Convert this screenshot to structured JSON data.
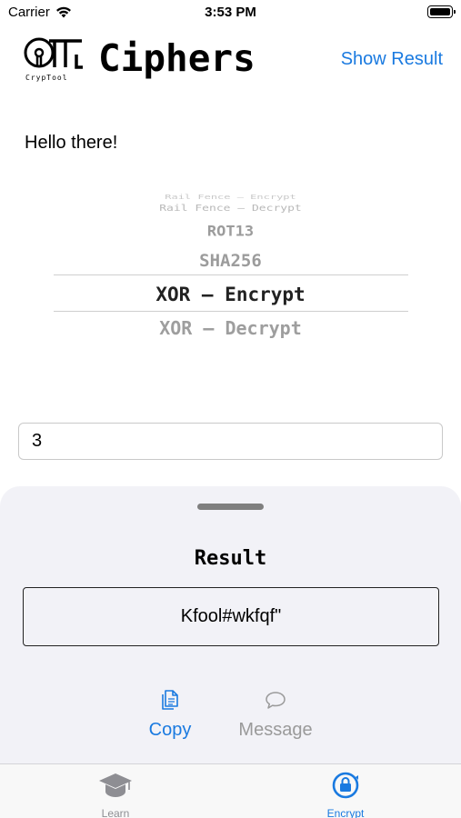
{
  "status_bar": {
    "carrier": "Carrier",
    "time": "3:53 PM"
  },
  "header": {
    "logo_text": "CrypTool",
    "title": "Ciphers",
    "show_result": "Show Result"
  },
  "input_text": "Hello there!",
  "picker": {
    "rows": [
      "Rail Fence – Encrypt",
      "Rail Fence – Decrypt",
      "ROT13",
      "SHA256",
      "XOR – Encrypt",
      "XOR – Decrypt"
    ],
    "selected": "XOR – Encrypt"
  },
  "key_field": {
    "value": "3"
  },
  "result_sheet": {
    "title": "Result",
    "value": "Kfool#wkfqf\"",
    "actions": [
      {
        "label": "Copy",
        "icon": "copy-icon",
        "color": "#1a7ae0"
      },
      {
        "label": "Message",
        "icon": "message-icon",
        "color": "#9a9a9a"
      }
    ]
  },
  "tab_bar": {
    "tabs": [
      {
        "label": "Learn",
        "icon": "graduation-cap-icon",
        "active": false
      },
      {
        "label": "Encrypt",
        "icon": "encrypt-lock-icon",
        "active": true
      }
    ]
  },
  "colors": {
    "accent": "#1a7ae0",
    "sheet_background": "#f2f2f7",
    "inactive": "#8e8e93"
  }
}
